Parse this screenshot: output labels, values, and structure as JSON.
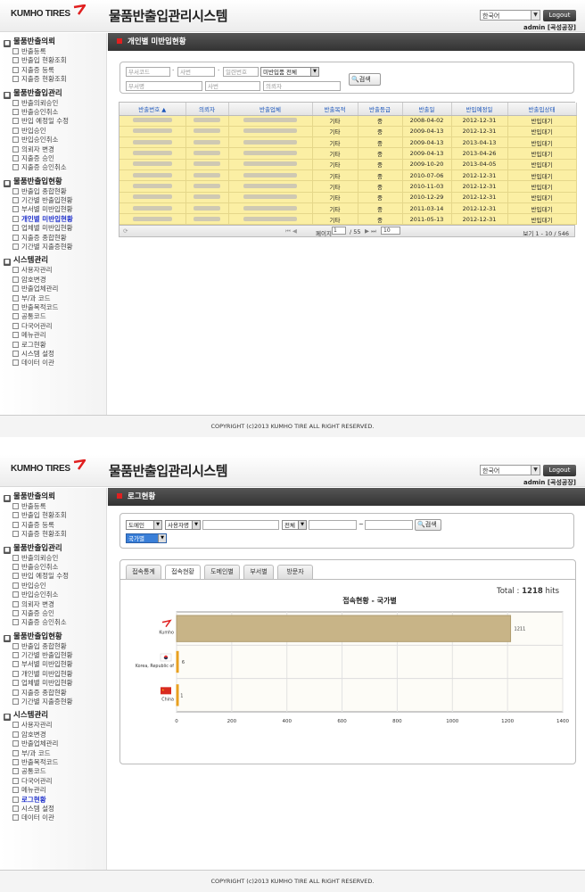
{
  "app": {
    "logo": "KUMHO TIRES",
    "title": "물품반출입관리시스템",
    "language": "한국어",
    "logout": "Logout",
    "user": "admin [곡성공장]"
  },
  "sidebar": [
    {
      "label": "물품반출의뢰",
      "items": [
        "반출등록",
        "반출입 현황조회",
        "지출증 등록",
        "지출증 현황조회"
      ]
    },
    {
      "label": "물품반출입관리",
      "items": [
        "반출의뢰승인",
        "반출승인취소",
        "반입 예정일 수정",
        "반입승인",
        "반입승인취소",
        "의뢰자 변경",
        "지출증 승인",
        "지출증 승인취소"
      ]
    },
    {
      "label": "물품반출입현황",
      "items": [
        "반출입 종합현황",
        "기간별 반출입현황",
        "부서별 미반입현황",
        "개인별 미반입현황",
        "업체별 미반입현황",
        "지출증 종합현황",
        "기간별 지출증현황"
      ]
    },
    {
      "label": "시스템관리",
      "items": [
        "사용자관리",
        "암호변경",
        "반출업체관리",
        "부/과 코드",
        "반출목적코드",
        "공통코드",
        "다국어관리",
        "메뉴관리",
        "로그현황",
        "시스템 설정",
        "데이터 이관"
      ]
    }
  ],
  "page1": {
    "title": "개인별 미반입현황",
    "active_item": "개인별 미반입현황",
    "search": {
      "dept_code": "부서코드",
      "sabun": "사번",
      "doc_no": "일련번호",
      "status": "미반입품 전체",
      "dept_name": "부서명",
      "emp": "사번",
      "requester": "의뢰자",
      "button": "검색"
    },
    "columns": [
      "반출번호 ▲",
      "의뢰자",
      "반출업체",
      "반출목적",
      "반출등급",
      "반출일",
      "반입예정일",
      "반출입상태"
    ],
    "rows": [
      [
        "기타",
        "중",
        "2008-04-02",
        "2012-12-31",
        "반입대기"
      ],
      [
        "기타",
        "중",
        "2009-04-13",
        "2012-12-31",
        "반입대기"
      ],
      [
        "기타",
        "중",
        "2009-04-13",
        "2013-04-13",
        "반입대기"
      ],
      [
        "기타",
        "중",
        "2009-04-13",
        "2013-04-26",
        "반입대기"
      ],
      [
        "기타",
        "중",
        "2009-10-20",
        "2013-04-05",
        "반입대기"
      ],
      [
        "기타",
        "중",
        "2010-07-06",
        "2012-12-31",
        "반입대기"
      ],
      [
        "기타",
        "중",
        "2010-11-03",
        "2012-12-31",
        "반입대기"
      ],
      [
        "기타",
        "중",
        "2010-12-29",
        "2012-12-31",
        "반입대기"
      ],
      [
        "기타",
        "중",
        "2011-03-14",
        "2012-12-31",
        "반입대기"
      ],
      [
        "기타",
        "중",
        "2011-05-13",
        "2012-12-31",
        "반입대기"
      ]
    ],
    "pager": {
      "page_label": "페이지",
      "page": "1",
      "of": "/ 55",
      "size": "10",
      "range": "보기 1 - 10 / 546"
    }
  },
  "page2": {
    "title": "로그현황",
    "active_item": "로그현황",
    "filters": {
      "domain": "도메인",
      "user": "사용자명",
      "period": "전체",
      "dash": "~",
      "group": "국가별",
      "button": "검색"
    },
    "tabs": [
      "접속통계",
      "접속현황",
      "도메인별",
      "부서별",
      "방문자"
    ],
    "total_label": "Total :",
    "total_value": "1218",
    "total_unit": "hits"
  },
  "chart_data": {
    "type": "bar",
    "orientation": "horizontal",
    "title": "접속현황 - 국가별",
    "categories": [
      "Kumho",
      "Korea, Republic of",
      "China"
    ],
    "values": [
      1211,
      6,
      1
    ],
    "value_labels": [
      "1211",
      "6",
      "1"
    ],
    "xlim": [
      0,
      1400
    ],
    "ticks": [
      "0",
      "200",
      "400",
      "600",
      "800",
      "1000",
      "1200",
      "1400"
    ],
    "grid": true,
    "colors": {
      "Kumho": "#c8b487",
      "Korea, Republic of": "#e8a020",
      "China": "#e8a020"
    }
  },
  "footer": "COPYRIGHT (c)2013 KUMHO TIRE ALL RIGHT RESERVED."
}
